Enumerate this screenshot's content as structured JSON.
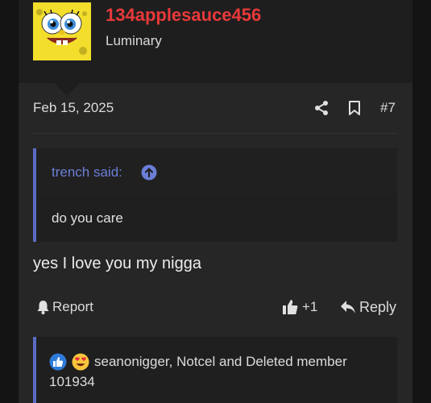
{
  "user": {
    "name": "134applesauce456",
    "title": "Luminary"
  },
  "post": {
    "date": "Feb 15, 2025",
    "number": "#7",
    "message": "yes I love you my nigga"
  },
  "quote": {
    "author": "trench said:",
    "body": "do you care"
  },
  "actions": {
    "report_label": "Report",
    "like_count": "+1",
    "reply_label": "Reply"
  },
  "reactions": {
    "text": "seanonigger, Notcel and Deleted member 101934"
  },
  "colors": {
    "username": "#e8393a",
    "quote_accent": "#5b6cc4",
    "background": "#262626"
  }
}
